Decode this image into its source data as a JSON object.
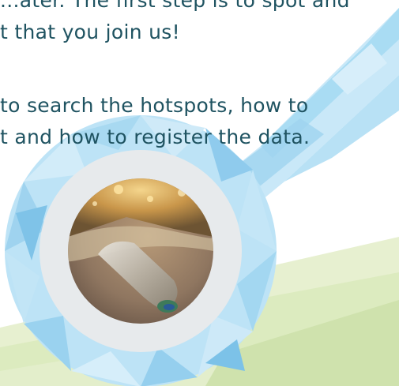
{
  "paragraph_1": {
    "line_1": "...ater. The first step is to spot and",
    "line_2": "t that you join us!"
  },
  "paragraph_2": {
    "line_1": "to search the hotspots, how to",
    "line_2": "t and how to register the data."
  },
  "photo": {
    "alt": "Plastic bottle washed up on a sandy beach at sunset"
  },
  "colors": {
    "text": "#1f5361",
    "magnifier_light": "#c9e8f8",
    "magnifier_mid": "#9fd3ef",
    "magnifier_dark": "#6bbde6",
    "ring_inner": "#e7eaec",
    "ground_green": "#dcebbf"
  }
}
